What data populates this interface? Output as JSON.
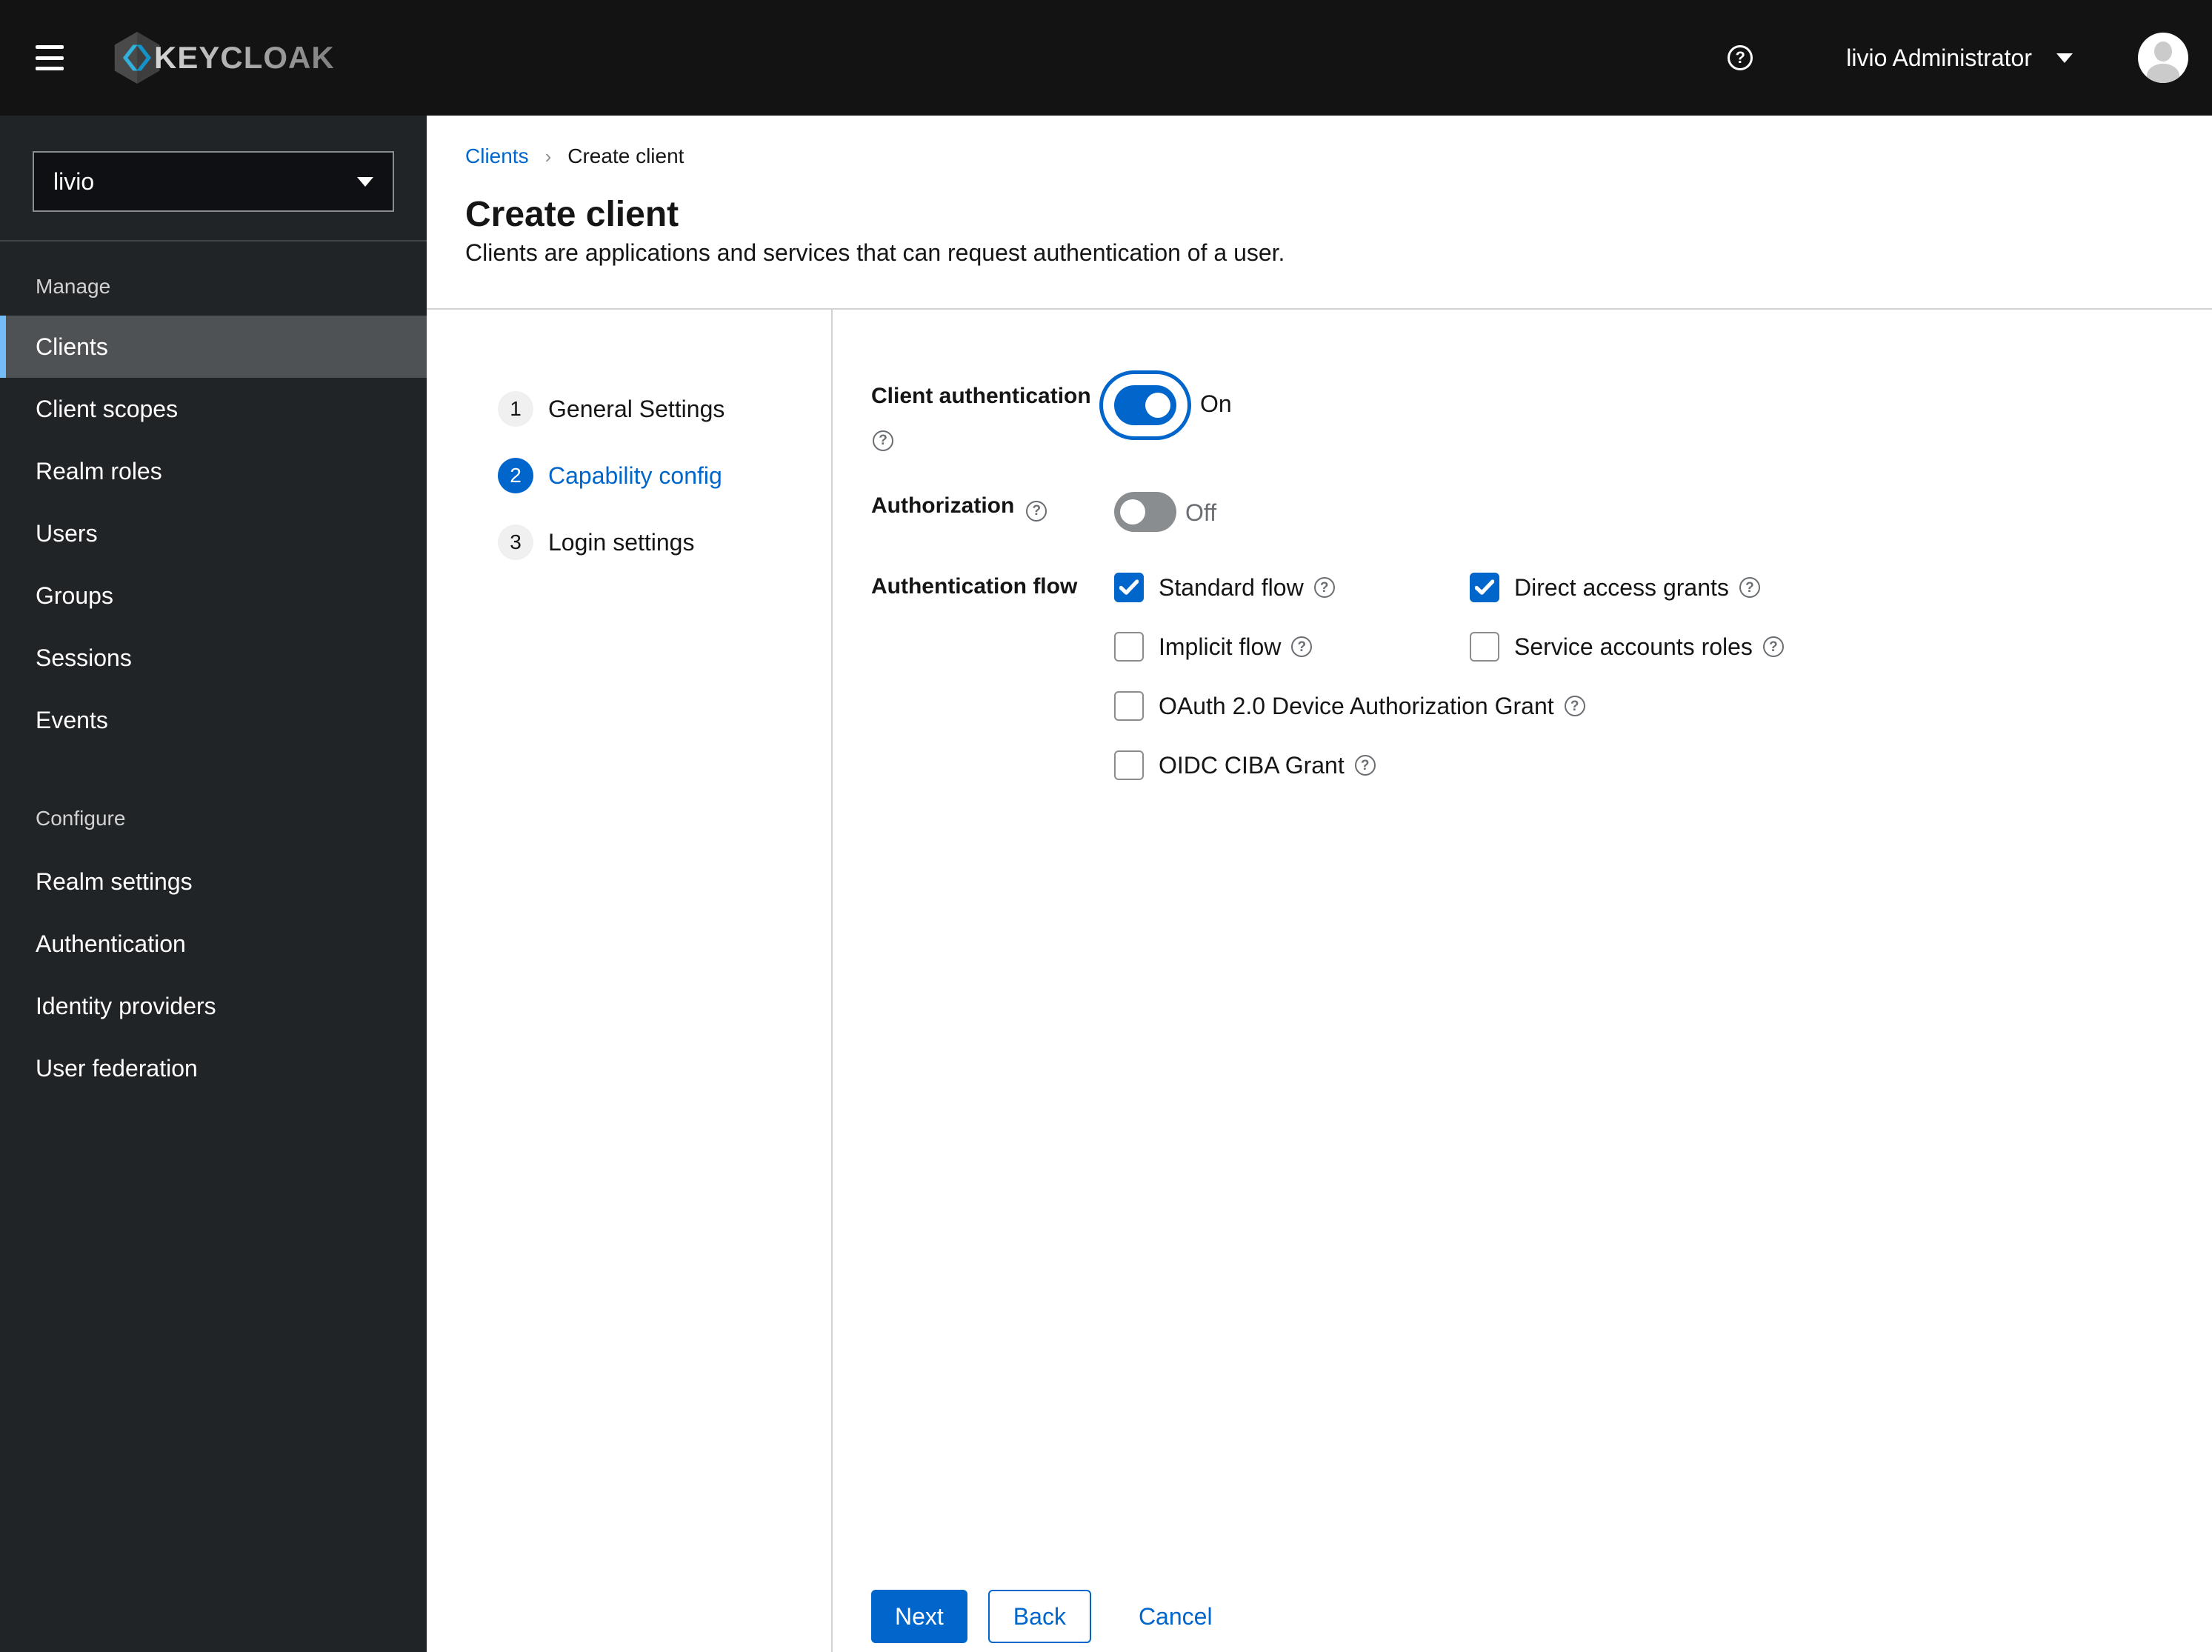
{
  "masthead": {
    "brand": "KEYCLOAK",
    "user": "livio Administrator"
  },
  "sidebar": {
    "realm": "livio",
    "groups": [
      {
        "label": "Manage",
        "items": [
          {
            "label": "Clients",
            "selected": true
          },
          {
            "label": "Client scopes"
          },
          {
            "label": "Realm roles"
          },
          {
            "label": "Users"
          },
          {
            "label": "Groups"
          },
          {
            "label": "Sessions"
          },
          {
            "label": "Events"
          }
        ]
      },
      {
        "label": "Configure",
        "items": [
          {
            "label": "Realm settings"
          },
          {
            "label": "Authentication"
          },
          {
            "label": "Identity providers"
          },
          {
            "label": "User federation"
          }
        ]
      }
    ]
  },
  "breadcrumb": {
    "clients": "Clients",
    "current": "Create client"
  },
  "page": {
    "title": "Create client",
    "subtitle": "Clients are applications and services that can request authentication of a user."
  },
  "wizard": {
    "steps": [
      {
        "num": "1",
        "label": "General Settings",
        "active": false
      },
      {
        "num": "2",
        "label": "Capability config",
        "active": true
      },
      {
        "num": "3",
        "label": "Login settings",
        "active": false
      }
    ]
  },
  "form": {
    "client_auth": {
      "label": "Client authentication",
      "state": "On",
      "on": true
    },
    "authorization": {
      "label": "Authorization",
      "state": "Off",
      "on": false
    },
    "auth_flow": {
      "label": "Authentication flow",
      "options": [
        {
          "label": "Standard flow",
          "checked": true
        },
        {
          "label": "Direct access grants",
          "checked": true
        },
        {
          "label": "Implicit flow",
          "checked": false
        },
        {
          "label": "Service accounts roles",
          "checked": false
        },
        {
          "label": "OAuth 2.0 Device Authorization Grant",
          "checked": false
        },
        {
          "label": "OIDC CIBA Grant",
          "checked": false
        }
      ]
    }
  },
  "footer": {
    "next": "Next",
    "back": "Back",
    "cancel": "Cancel"
  },
  "colors": {
    "primary": "#0066cc",
    "selected_nav_bg": "#4f5255",
    "nav_accent": "#73bcf7",
    "masthead_bg": "#131313",
    "sidebar_bg": "#212427",
    "divider": "#d2d2d2"
  }
}
